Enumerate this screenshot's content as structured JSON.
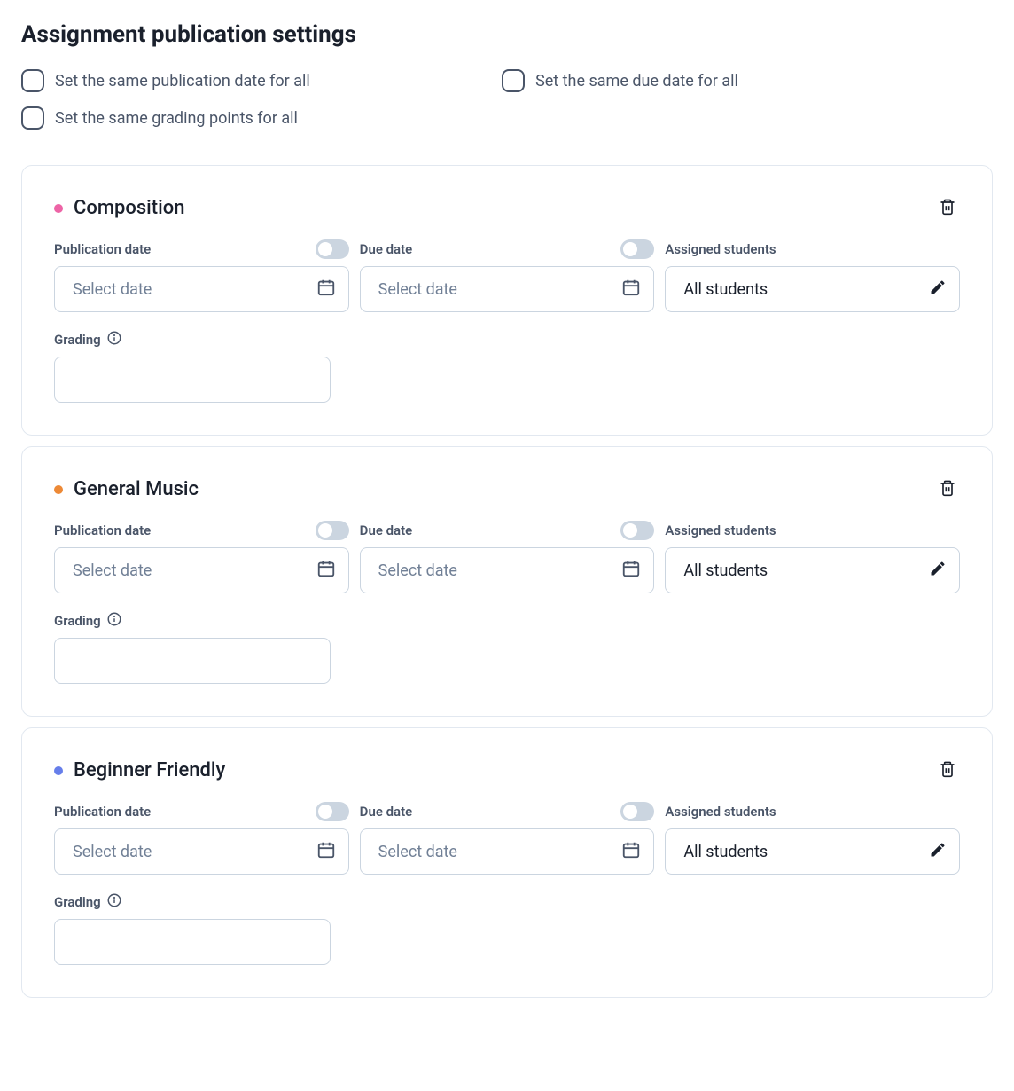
{
  "page_title": "Assignment publication settings",
  "checkboxes": {
    "same_pub_date": "Set the same publication date for all",
    "same_due_date": "Set the same due date for all",
    "same_grading": "Set the same grading points for all"
  },
  "labels": {
    "publication_date": "Publication date",
    "due_date": "Due date",
    "assigned_students": "Assigned students",
    "grading": "Grading",
    "select_date": "Select date",
    "all_students": "All students"
  },
  "cards": [
    {
      "title": "Composition",
      "dot_color": "#ed64a6"
    },
    {
      "title": "General Music",
      "dot_color": "#ed8936"
    },
    {
      "title": "Beginner Friendly",
      "dot_color": "#667eea"
    }
  ]
}
